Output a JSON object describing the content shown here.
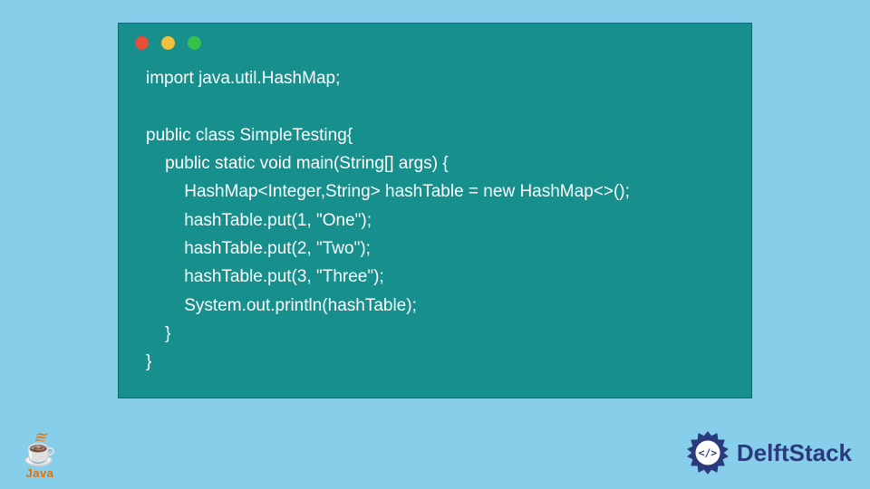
{
  "code": {
    "line1": "import java.util.HashMap;",
    "line2": "",
    "line3": "public class SimpleTesting{",
    "line4": "    public static void main(String[] args) {",
    "line5": "        HashMap<Integer,String> hashTable = new HashMap<>();",
    "line6": "        hashTable.put(1, \"One\");",
    "line7": "        hashTable.put(2, \"Two\");",
    "line8": "        hashTable.put(3, \"Three\");",
    "line9": "        System.out.println(hashTable);",
    "line10": "    }",
    "line11": "}"
  },
  "logos": {
    "java_label": "Java",
    "delftstack_label": "DelftStack"
  },
  "colors": {
    "page_bg": "#87ceeb",
    "window_bg": "#168f8d",
    "code_text": "#ffffff",
    "dot_red": "#e94e3a",
    "dot_yellow": "#f2c13c",
    "dot_green": "#35c24a",
    "java_blue": "#5382a1",
    "java_orange": "#e76f00",
    "delft_blue": "#2a3a7c"
  }
}
